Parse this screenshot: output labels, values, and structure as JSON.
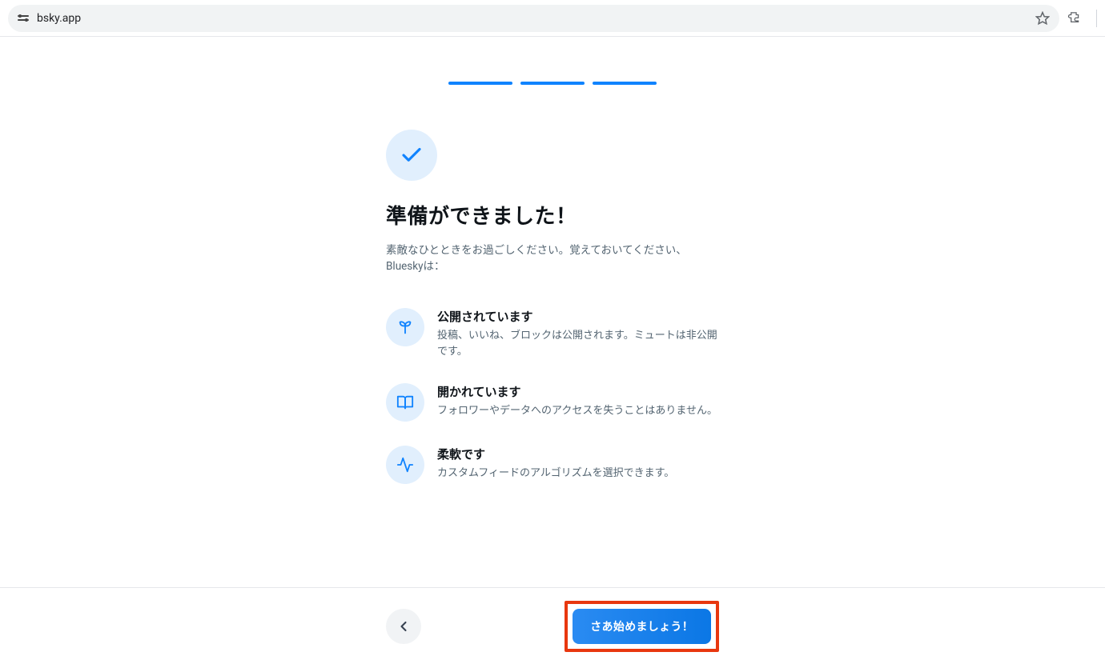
{
  "browser": {
    "url": "bsky.app"
  },
  "progress": {
    "total": 3,
    "current": 3
  },
  "header": {
    "title": "準備ができました！",
    "subtitle": "素敵なひとときをお過ごしください。覚えておいてください、Blueskyは："
  },
  "features": [
    {
      "icon": "sprout-icon",
      "title": "公開されています",
      "desc": "投稿、いいね、ブロックは公開されます。ミュートは非公開です。"
    },
    {
      "icon": "book-open-icon",
      "title": "開かれています",
      "desc": "フォロワーやデータへのアクセスを失うことはありません。"
    },
    {
      "icon": "activity-icon",
      "title": "柔軟です",
      "desc": "カスタムフィードのアルゴリズムを選択できます。"
    }
  ],
  "footer": {
    "start_label": "さあ始めましょう！"
  },
  "colors": {
    "accent": "#1083fe",
    "accent_light": "#e1effd",
    "highlight_border": "#e8370f"
  }
}
